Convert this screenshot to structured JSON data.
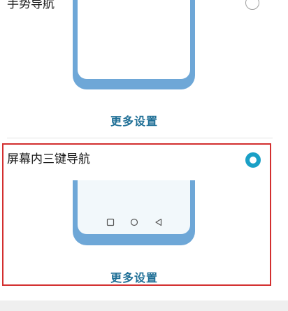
{
  "gesture": {
    "title": "手势导航",
    "selected": false,
    "more_label": "更多设置"
  },
  "threekey": {
    "title": "屏幕内三键导航",
    "selected": true,
    "more_label": "更多设置",
    "nav_icons": [
      "square-recent-icon",
      "circle-home-icon",
      "triangle-back-icon"
    ]
  },
  "colors": {
    "accent": "#1aa0c6",
    "link": "#1f6f96",
    "phone_frame": "#6ea7d7",
    "highlight_border": "#d32f2f"
  }
}
